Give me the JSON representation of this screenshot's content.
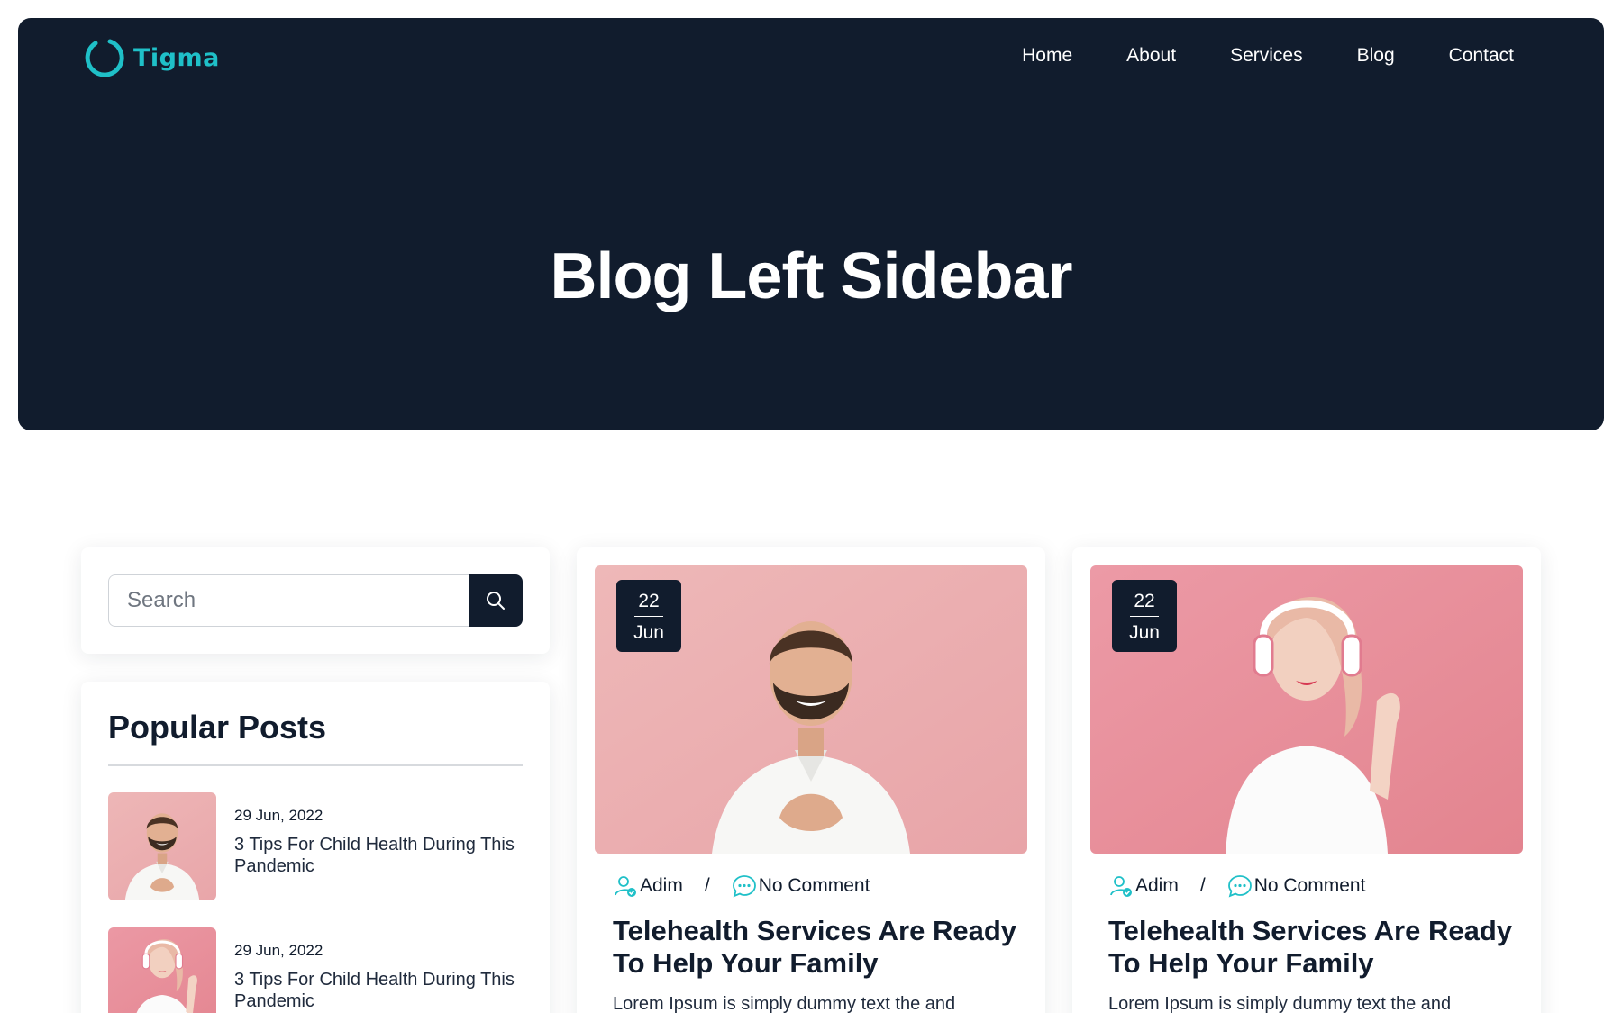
{
  "brand": {
    "name": "Tigma",
    "accent": "#1fc0c8",
    "dark": "#111c2d"
  },
  "nav": {
    "items": [
      "Home",
      "About",
      "Services",
      "Blog",
      "Contact"
    ]
  },
  "hero": {
    "title": "Blog Left Sidebar"
  },
  "sidebar": {
    "search": {
      "placeholder": "Search",
      "icon": "search-icon"
    },
    "popular": {
      "title": "Popular Posts",
      "posts": [
        {
          "date": "29 Jun, 2022",
          "title": "3 Tips For Child Health During This Pandemic",
          "image": "man-in-white-shirt"
        },
        {
          "date": "29 Jun, 2022",
          "title": "3 Tips For Child Health During This Pandemic",
          "image": "woman-with-headphones"
        }
      ]
    }
  },
  "posts": [
    {
      "day": "22",
      "month": "Jun",
      "author": "Adim",
      "separator": "/",
      "comments": "No Comment",
      "title": "Telehealth Services Are Ready To Help Your Family",
      "excerpt": "Lorem Ipsum is simply dummy text the and",
      "image": "man-in-white-shirt"
    },
    {
      "day": "22",
      "month": "Jun",
      "author": "Adim",
      "separator": "/",
      "comments": "No Comment",
      "title": "Telehealth Services Are Ready To Help Your Family",
      "excerpt": "Lorem Ipsum is simply dummy text the and",
      "image": "woman-with-headphones"
    }
  ]
}
